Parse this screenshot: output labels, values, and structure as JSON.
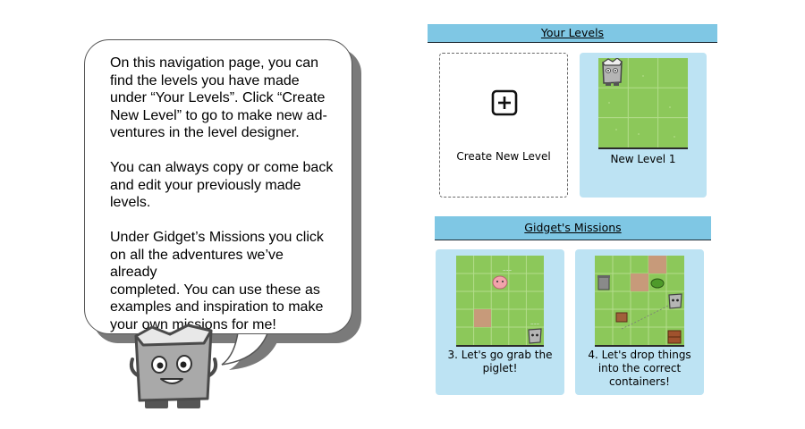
{
  "bubble": {
    "paragraphs": [
      [
        "On this navigation page, you can",
        "find the levels you have made",
        "under “Your Levels”. Click “Create",
        "New Level” to go to make new ad-",
        "ventures in the level designer."
      ],
      [
        "You can always copy or come back",
        "and edit your previously made",
        "levels."
      ],
      [
        "Under Gidget’s Missions you click",
        "on all the adventures we’ve already",
        "completed. You can use these as",
        "examples and inspiration to make",
        "your own missions for me!"
      ]
    ]
  },
  "your_levels": {
    "title": "Your Levels",
    "create_label": "Create New Level",
    "create_icon": "plus-square-icon",
    "levels": [
      {
        "label": "New Level 1"
      }
    ]
  },
  "missions": {
    "title": "Gidget's Missions",
    "items": [
      {
        "label_lines": [
          "3. Let's go grab the",
          "piglet!"
        ]
      },
      {
        "label_lines": [
          "4. Let's drop things",
          "into the correct",
          "containers!"
        ]
      }
    ]
  },
  "colors": {
    "header_bg": "#7fc7e4",
    "card_bg": "#bde3f3",
    "grass": "#8cc85a",
    "dirt": "#c79a7a"
  }
}
